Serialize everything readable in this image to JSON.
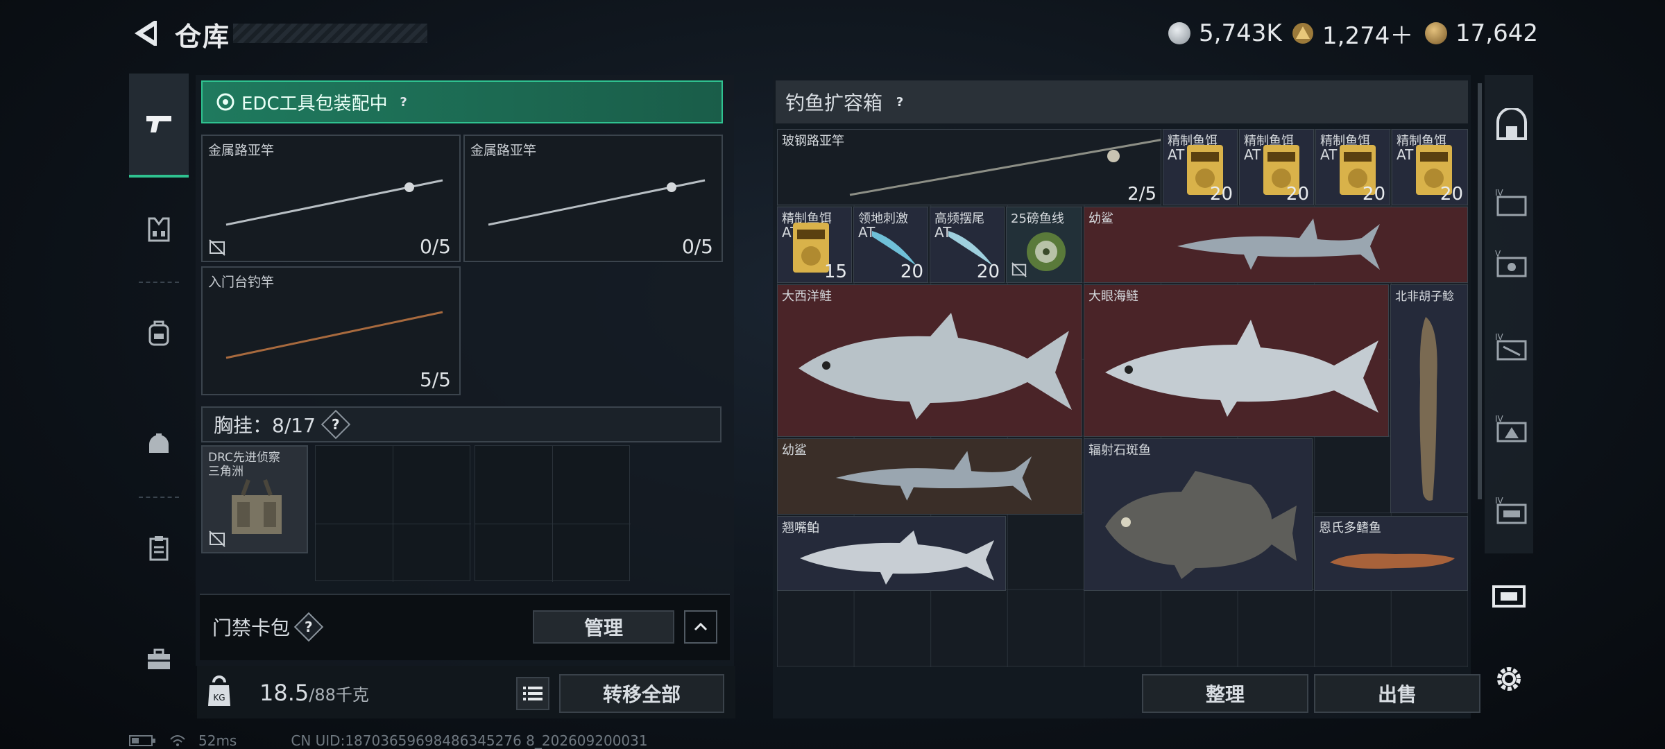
{
  "header": {
    "title": "仓库",
    "currencies": [
      {
        "icon": "silver-coin-icon",
        "value": "5,743K",
        "color": "#b8bec4"
      },
      {
        "icon": "gold-token-icon",
        "value": "1,274＋",
        "color": "#c9a35a"
      },
      {
        "icon": "bronze-coin-icon",
        "value": "17,642",
        "color": "#b48a4c"
      }
    ]
  },
  "left_nav": [
    "pistol-icon",
    "armor-vest-icon",
    "backpack-icon",
    "helmet-bag-icon",
    "clipboard-icon",
    "briefcase-icon"
  ],
  "loadout": {
    "edc_label": "EDC工具包装配中",
    "edc_help": "?",
    "slots": [
      {
        "name": "金属路亚竿",
        "count": "0/5"
      },
      {
        "name": "金属路亚竿",
        "count": "0/5"
      },
      {
        "name": "入门台钓竿",
        "count": "5/5"
      }
    ],
    "chest_label": "胸挂：",
    "chest_value": "8/17",
    "chest_help": "?",
    "chest_item_line1": "DRC先进侦察",
    "chest_item_line2": "三角洲",
    "keycard_label": "门禁卡包",
    "keycard_help": "?",
    "manage_label": "管理",
    "weight_value": "18.5",
    "weight_max": "/88千克",
    "transfer_label": "转移全部"
  },
  "box": {
    "title": "钓鱼扩容箱",
    "help": "?",
    "items": [
      {
        "name": "玻钢路亚竿",
        "count": "2/5"
      },
      {
        "name": "精制鱼饵",
        "sub": "AT",
        "count": "20"
      },
      {
        "name": "精制鱼饵",
        "sub": "AT",
        "count": "20"
      },
      {
        "name": "精制鱼饵",
        "sub": "AT",
        "count": "20"
      },
      {
        "name": "精制鱼饵",
        "sub": "AT",
        "count": "20"
      },
      {
        "name": "精制鱼饵",
        "sub": "AT",
        "count": "15"
      },
      {
        "name": "领地刺激",
        "sub": "AT",
        "count": "20"
      },
      {
        "name": "高频摆尾",
        "sub": "AT",
        "count": "20"
      },
      {
        "name": "25磅鱼线",
        "count": ""
      },
      {
        "name": "幼鲨"
      },
      {
        "name": "大西洋鲑"
      },
      {
        "name": "大眼海鲢"
      },
      {
        "name": "北非胡子鲶"
      },
      {
        "name": "幼鲨"
      },
      {
        "name": "辐射石斑鱼"
      },
      {
        "name": "翘嘴鲌"
      },
      {
        "name": "恩氏多鳍鱼"
      }
    ],
    "sort_label": "整理",
    "sell_label": "出售"
  },
  "right_nav": [
    "armory-icon",
    "case-iv-icon",
    "case-v-icon",
    "case-iv-2-icon",
    "case-iv-3-icon",
    "case-iv-4-icon",
    "safe-box-icon",
    "settings-gear-icon"
  ],
  "status": {
    "ping": "52ms",
    "uid": "CN UID:18703659698486345276 8_202609200031"
  }
}
